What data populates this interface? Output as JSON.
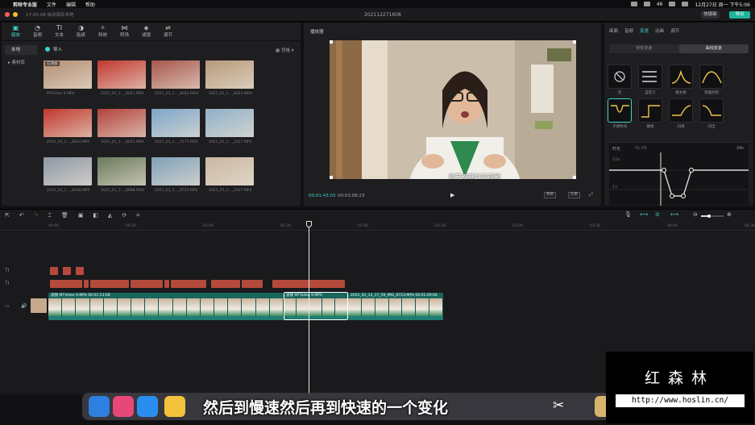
{
  "menubar": {
    "app_name": "剪映专业版",
    "items": [
      "文件",
      "编辑",
      "帮助"
    ],
    "battery": "46",
    "clock": "12月27日 周一 下午5:06"
  },
  "titlebar": {
    "saved_status": "17:05:08 自动保存本地",
    "project_title": "202112271608",
    "shortcut_label": "快捷键",
    "export_label": "导出"
  },
  "media": {
    "tabs": [
      {
        "label": "媒体",
        "icon": "media-icon"
      },
      {
        "label": "音频",
        "icon": "audio-icon"
      },
      {
        "label": "文本",
        "icon": "text-icon"
      },
      {
        "label": "贴纸",
        "icon": "sticker-icon"
      },
      {
        "label": "特效",
        "icon": "effects-icon"
      },
      {
        "label": "转场",
        "icon": "transition-icon"
      },
      {
        "label": "滤镜",
        "icon": "filter-icon"
      },
      {
        "label": "调节",
        "icon": "adjust-icon"
      }
    ],
    "side_nav": [
      "本地",
      "素材库"
    ],
    "import_label": "导入",
    "sort_label": "宫格",
    "added_badge": "已添加",
    "clips": [
      {
        "name": "MTVideo 9.MP4",
        "color": "#b48d72"
      },
      {
        "name": "2021_01_1..._8021.MP4",
        "color": "#c2382f"
      },
      {
        "name": "2021_01_1..._8022.MOV",
        "color": "#a8574c"
      },
      {
        "name": "2021_01_1..._8023.MOV",
        "color": "#b79a7b"
      },
      {
        "name": "2021_01_1..._8024.MP4",
        "color": "#c0372c"
      },
      {
        "name": "2021_01_1..._8025.MP4",
        "color": "#b3423a"
      },
      {
        "name": "2021_01_1..._3177.MP4",
        "color": "#7da6c9"
      },
      {
        "name": "2021_01_1..._3217.MP4",
        "color": "#8fb0c8"
      },
      {
        "name": "2021_01_1..._8548.MP4",
        "color": "#8d98a6"
      },
      {
        "name": "2021_01_1..._8688.MOV",
        "color": "#6a7a5c"
      },
      {
        "name": "2021_01_1..._8723.MP4",
        "color": "#7fa0b8"
      },
      {
        "name": "2021_01_1..._3227.MP4",
        "color": "#c9b7a2"
      }
    ]
  },
  "player": {
    "title": "播放器",
    "subtitle": "嗣节奏感好的视频",
    "current_time": "00:01:43:03",
    "total_time": "00:03:06:23",
    "btn_original": "原始",
    "btn_ratio": "比例"
  },
  "inspector": {
    "tabs": [
      "画面",
      "音频",
      "变速",
      "动画",
      "调节"
    ],
    "active_tab": "变速",
    "seg": [
      "常规变速",
      "曲线变速"
    ],
    "presets": [
      "无",
      "自定义",
      "蒙太奇",
      "英雄时刻",
      "子弹时间",
      "跳接",
      "闪进",
      "闪出"
    ],
    "duration_label": "时长",
    "duration_from": "01:09",
    "duration_to": "24s",
    "speed_high": "10x",
    "speed_low": "1x"
  },
  "timeline": {
    "ruler": [
      "00:00",
      "00:30",
      "01:00",
      "01:30",
      "02:00",
      "02:30",
      "03:00",
      "03:30",
      "04:00",
      "04:30"
    ],
    "clips": [
      {
        "filter": "滤镜",
        "name": "MTVideo 9.MP4",
        "time": "00:01:53:08"
      },
      {
        "filter": "滤镜",
        "name": "MTVideo 9.MP4",
        "time": ""
      },
      {
        "filter": "",
        "name": "2021_01_13_17_59_IMG_8723.MP4",
        "time": "00:01:09:04"
      }
    ]
  },
  "overlay": {
    "caption": "然后到慢速然后再到快速的一个变化",
    "wm_name": "红森林",
    "wm_url": "http://www.hoslin.cn/"
  }
}
